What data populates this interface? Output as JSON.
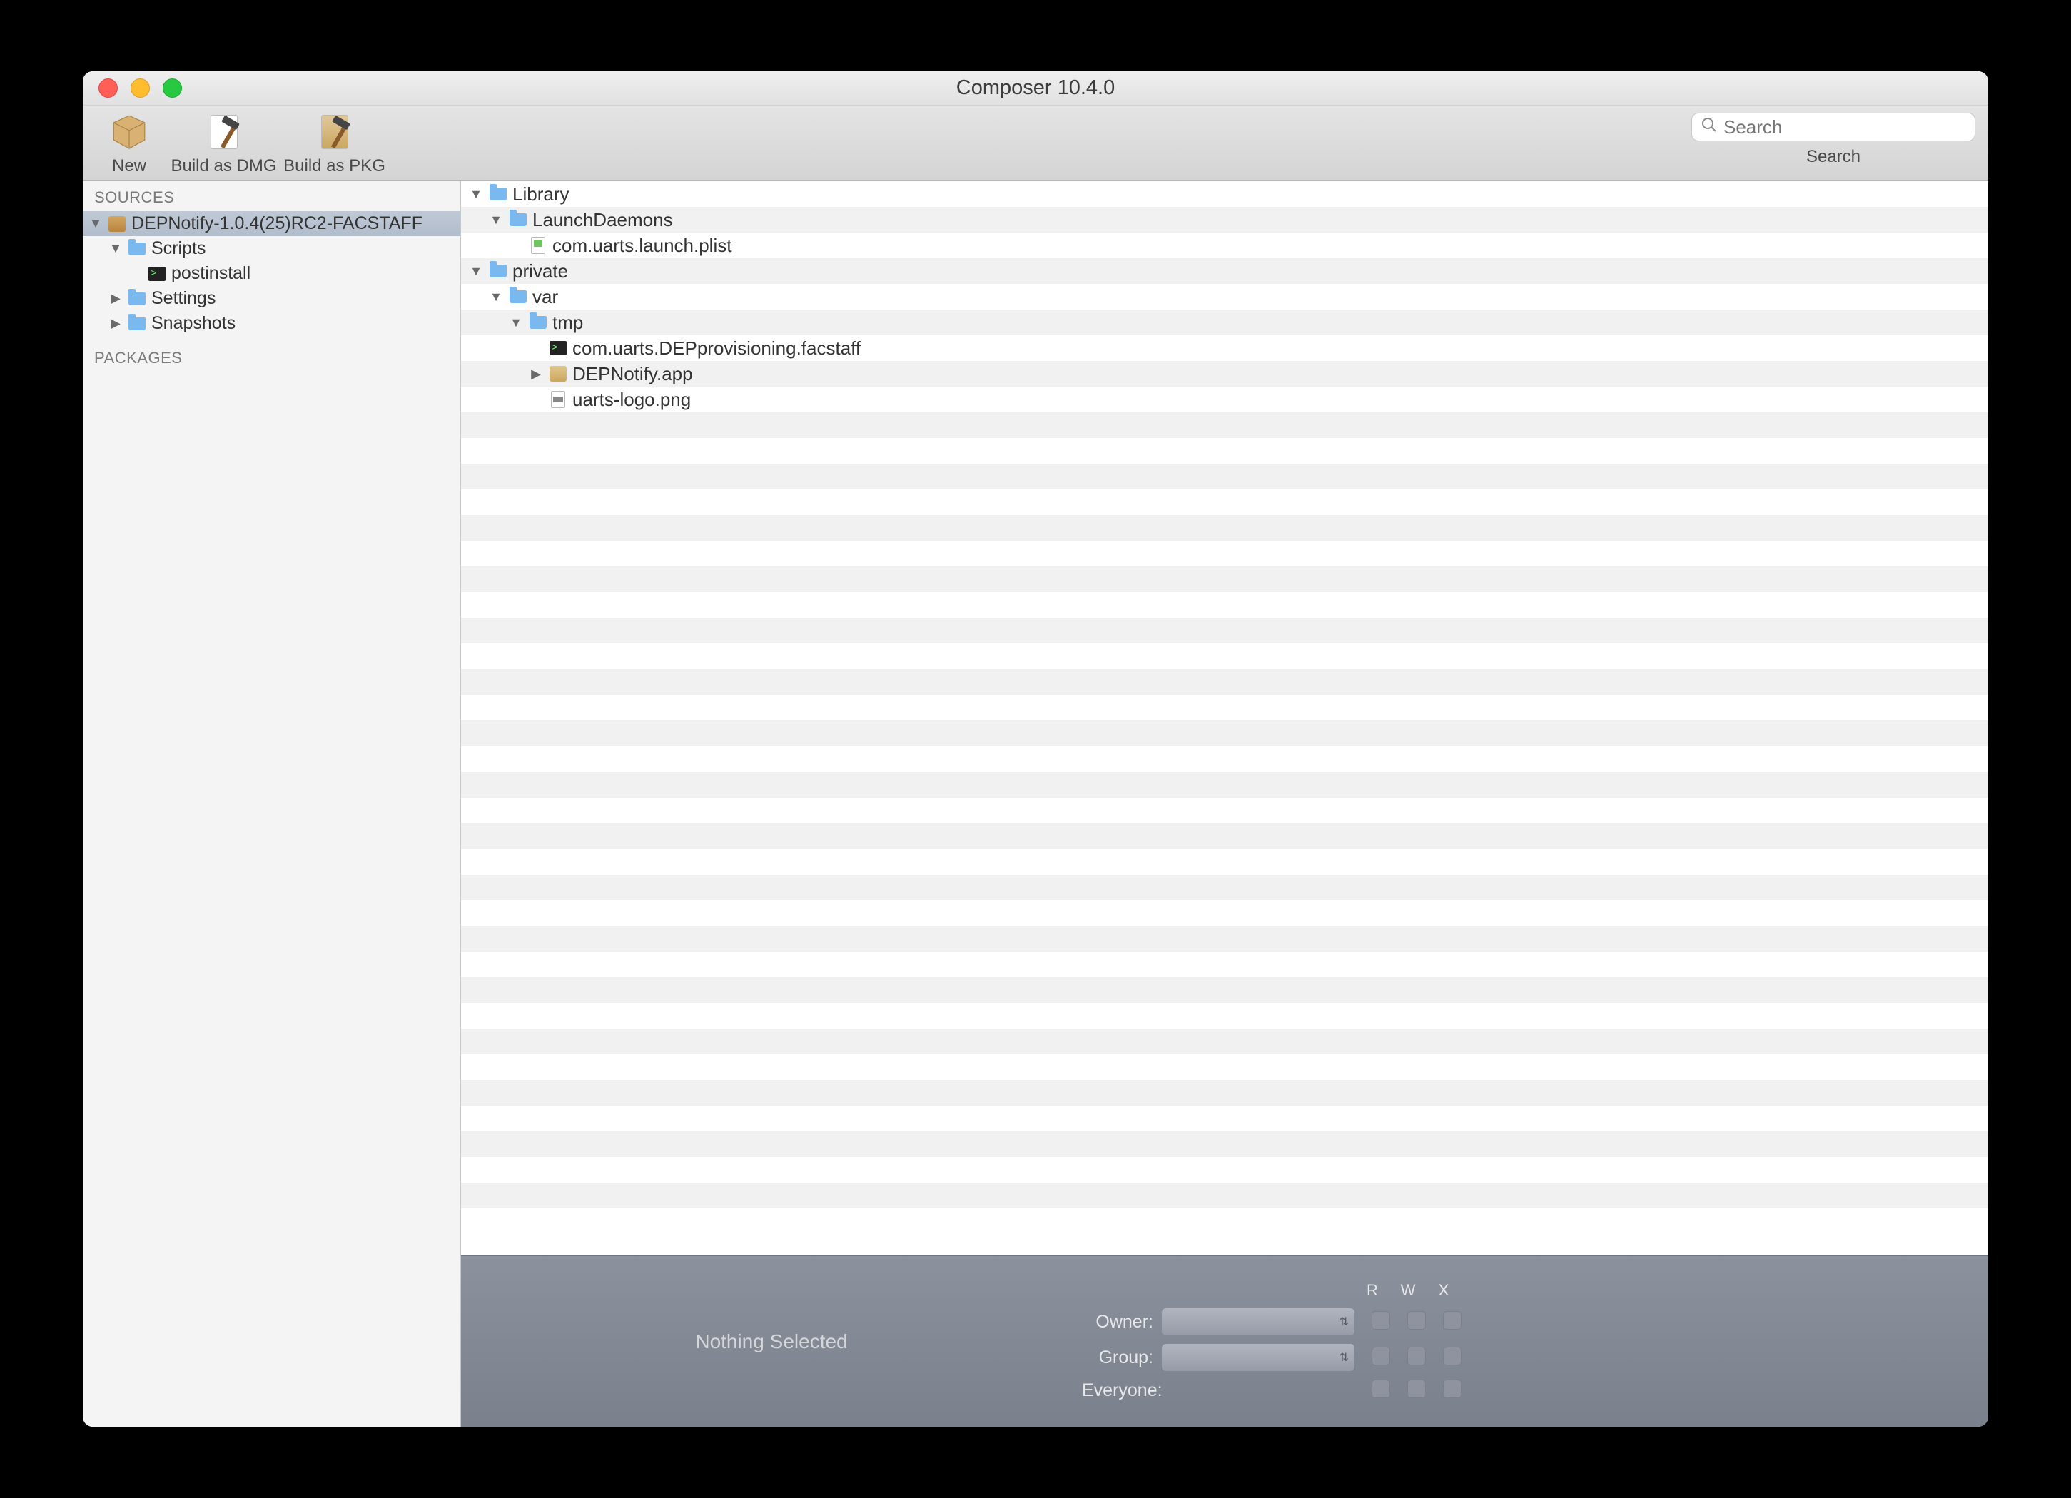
{
  "window": {
    "title": "Composer 10.4.0"
  },
  "toolbar": {
    "new_label": "New",
    "build_dmg_label": "Build as DMG",
    "build_pkg_label": "Build as PKG",
    "search_label": "Search",
    "search_placeholder": "Search"
  },
  "sidebar": {
    "header_sources": "SOURCES",
    "header_packages": "PACKAGES",
    "items": [
      {
        "label": "DEPNotify-1.0.4(25)RC2-FACSTAFF",
        "icon": "pkg",
        "expanded": true,
        "indent": 0,
        "selected": true
      },
      {
        "label": "Scripts",
        "icon": "folder",
        "expanded": true,
        "indent": 1
      },
      {
        "label": "postinstall",
        "icon": "term",
        "indent": 2
      },
      {
        "label": "Settings",
        "icon": "folder",
        "expanded": false,
        "indent": 1
      },
      {
        "label": "Snapshots",
        "icon": "folder",
        "expanded": false,
        "indent": 1
      }
    ]
  },
  "tree": [
    {
      "label": "Library",
      "icon": "folder",
      "expanded": true,
      "indent": 0
    },
    {
      "label": "LaunchDaemons",
      "icon": "folder",
      "expanded": true,
      "indent": 1
    },
    {
      "label": "com.uarts.launch.plist",
      "icon": "plist",
      "indent": 2
    },
    {
      "label": "private",
      "icon": "folder",
      "expanded": true,
      "indent": 0
    },
    {
      "label": "var",
      "icon": "folder",
      "expanded": true,
      "indent": 1
    },
    {
      "label": "tmp",
      "icon": "folder",
      "expanded": true,
      "indent": 2
    },
    {
      "label": "com.uarts.DEPprovisioning.facstaff",
      "icon": "term",
      "indent": 3
    },
    {
      "label": "DEPNotify.app",
      "icon": "app",
      "expanded": false,
      "indent": 3
    },
    {
      "label": "uarts-logo.png",
      "icon": "png",
      "indent": 3
    }
  ],
  "detail": {
    "nothing_selected": "Nothing Selected",
    "owner_label": "Owner:",
    "group_label": "Group:",
    "everyone_label": "Everyone:",
    "col_r": "R",
    "col_w": "W",
    "col_x": "X"
  }
}
